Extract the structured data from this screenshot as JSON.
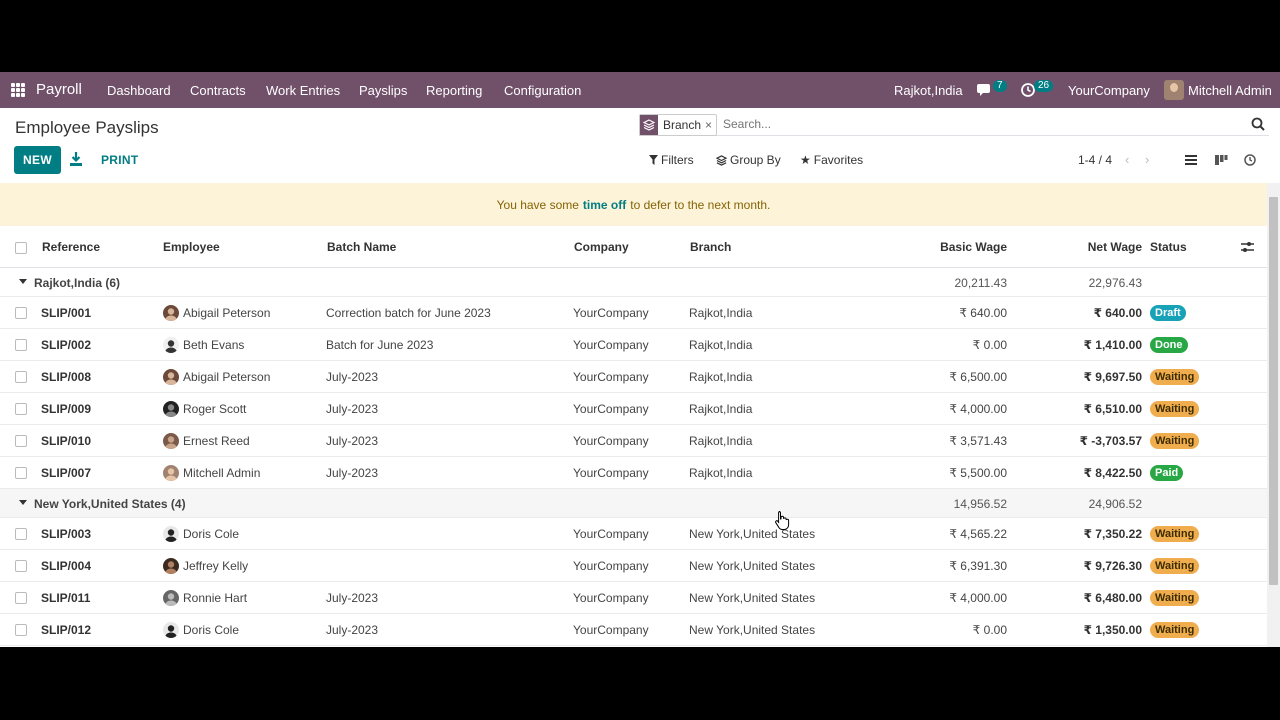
{
  "navbar": {
    "brand": "Payroll",
    "menu": [
      "Dashboard",
      "Contracts",
      "Work Entries",
      "Payslips",
      "Reporting",
      "Configuration"
    ],
    "location": "Rajkot,India",
    "messages_count": "7",
    "activities_count": "26",
    "company": "YourCompany",
    "user": "Mitchell Admin"
  },
  "control_panel": {
    "title": "Employee Payslips",
    "new_label": "NEW",
    "print_label": "PRINT",
    "facet": "Branch",
    "facet_close": "×",
    "search_placeholder": "Search...",
    "filters_label": "Filters",
    "groupby_label": "Group By",
    "favorites_label": "Favorites",
    "pager": "1-4 / 4"
  },
  "alert": {
    "prefix": "You have some",
    "link": "time off",
    "suffix": "to defer to the next month."
  },
  "table": {
    "columns": [
      "Reference",
      "Employee",
      "Batch Name",
      "Company",
      "Branch",
      "Basic Wage",
      "Net Wage",
      "Status"
    ],
    "groups": [
      {
        "label": "Rajkot,India (6)",
        "basic_total": "20,211.43",
        "net_total": "22,976.43",
        "rows": [
          {
            "ref": "SLIP/001",
            "employee": "Abigail Peterson",
            "batch": "Correction batch for June 2023",
            "company": "YourCompany",
            "branch": "Rajkot,India",
            "basic": "₹ 640.00",
            "net": "₹ 640.00",
            "status": "Draft"
          },
          {
            "ref": "SLIP/002",
            "employee": "Beth Evans",
            "batch": "Batch for June 2023",
            "company": "YourCompany",
            "branch": "Rajkot,India",
            "basic": "₹ 0.00",
            "net": "₹ 1,410.00",
            "status": "Done"
          },
          {
            "ref": "SLIP/008",
            "employee": "Abigail Peterson",
            "batch": "July-2023",
            "company": "YourCompany",
            "branch": "Rajkot,India",
            "basic": "₹ 6,500.00",
            "net": "₹ 9,697.50",
            "status": "Waiting"
          },
          {
            "ref": "SLIP/009",
            "employee": "Roger Scott",
            "batch": "July-2023",
            "company": "YourCompany",
            "branch": "Rajkot,India",
            "basic": "₹ 4,000.00",
            "net": "₹ 6,510.00",
            "status": "Waiting"
          },
          {
            "ref": "SLIP/010",
            "employee": "Ernest Reed",
            "batch": "July-2023",
            "company": "YourCompany",
            "branch": "Rajkot,India",
            "basic": "₹ 3,571.43",
            "net": "₹ -3,703.57",
            "status": "Waiting"
          },
          {
            "ref": "SLIP/007",
            "employee": "Mitchell Admin",
            "batch": "July-2023",
            "company": "YourCompany",
            "branch": "Rajkot,India",
            "basic": "₹ 5,500.00",
            "net": "₹ 8,422.50",
            "status": "Paid"
          }
        ]
      },
      {
        "label": "New York,United States (4)",
        "basic_total": "14,956.52",
        "net_total": "24,906.52",
        "rows": [
          {
            "ref": "SLIP/003",
            "employee": "Doris Cole",
            "batch": "",
            "company": "YourCompany",
            "branch": "New York,United States",
            "basic": "₹ 4,565.22",
            "net": "₹ 7,350.22",
            "status": "Waiting"
          },
          {
            "ref": "SLIP/004",
            "employee": "Jeffrey Kelly",
            "batch": "",
            "company": "YourCompany",
            "branch": "New York,United States",
            "basic": "₹ 6,391.30",
            "net": "₹ 9,726.30",
            "status": "Waiting"
          },
          {
            "ref": "SLIP/011",
            "employee": "Ronnie Hart",
            "batch": "July-2023",
            "company": "YourCompany",
            "branch": "New York,United States",
            "basic": "₹ 4,000.00",
            "net": "₹ 6,480.00",
            "status": "Waiting"
          },
          {
            "ref": "SLIP/012",
            "employee": "Doris Cole",
            "batch": "July-2023",
            "company": "YourCompany",
            "branch": "New York,United States",
            "basic": "₹ 0.00",
            "net": "₹ 1,350.00",
            "status": "Waiting"
          }
        ]
      }
    ]
  },
  "colors": {
    "navbar": "#71506a",
    "primary": "#017e84",
    "alert_bg": "#fcf3d9",
    "draft": "#17a2b8",
    "done": "#28a745",
    "waiting": "#f0ad4e"
  }
}
